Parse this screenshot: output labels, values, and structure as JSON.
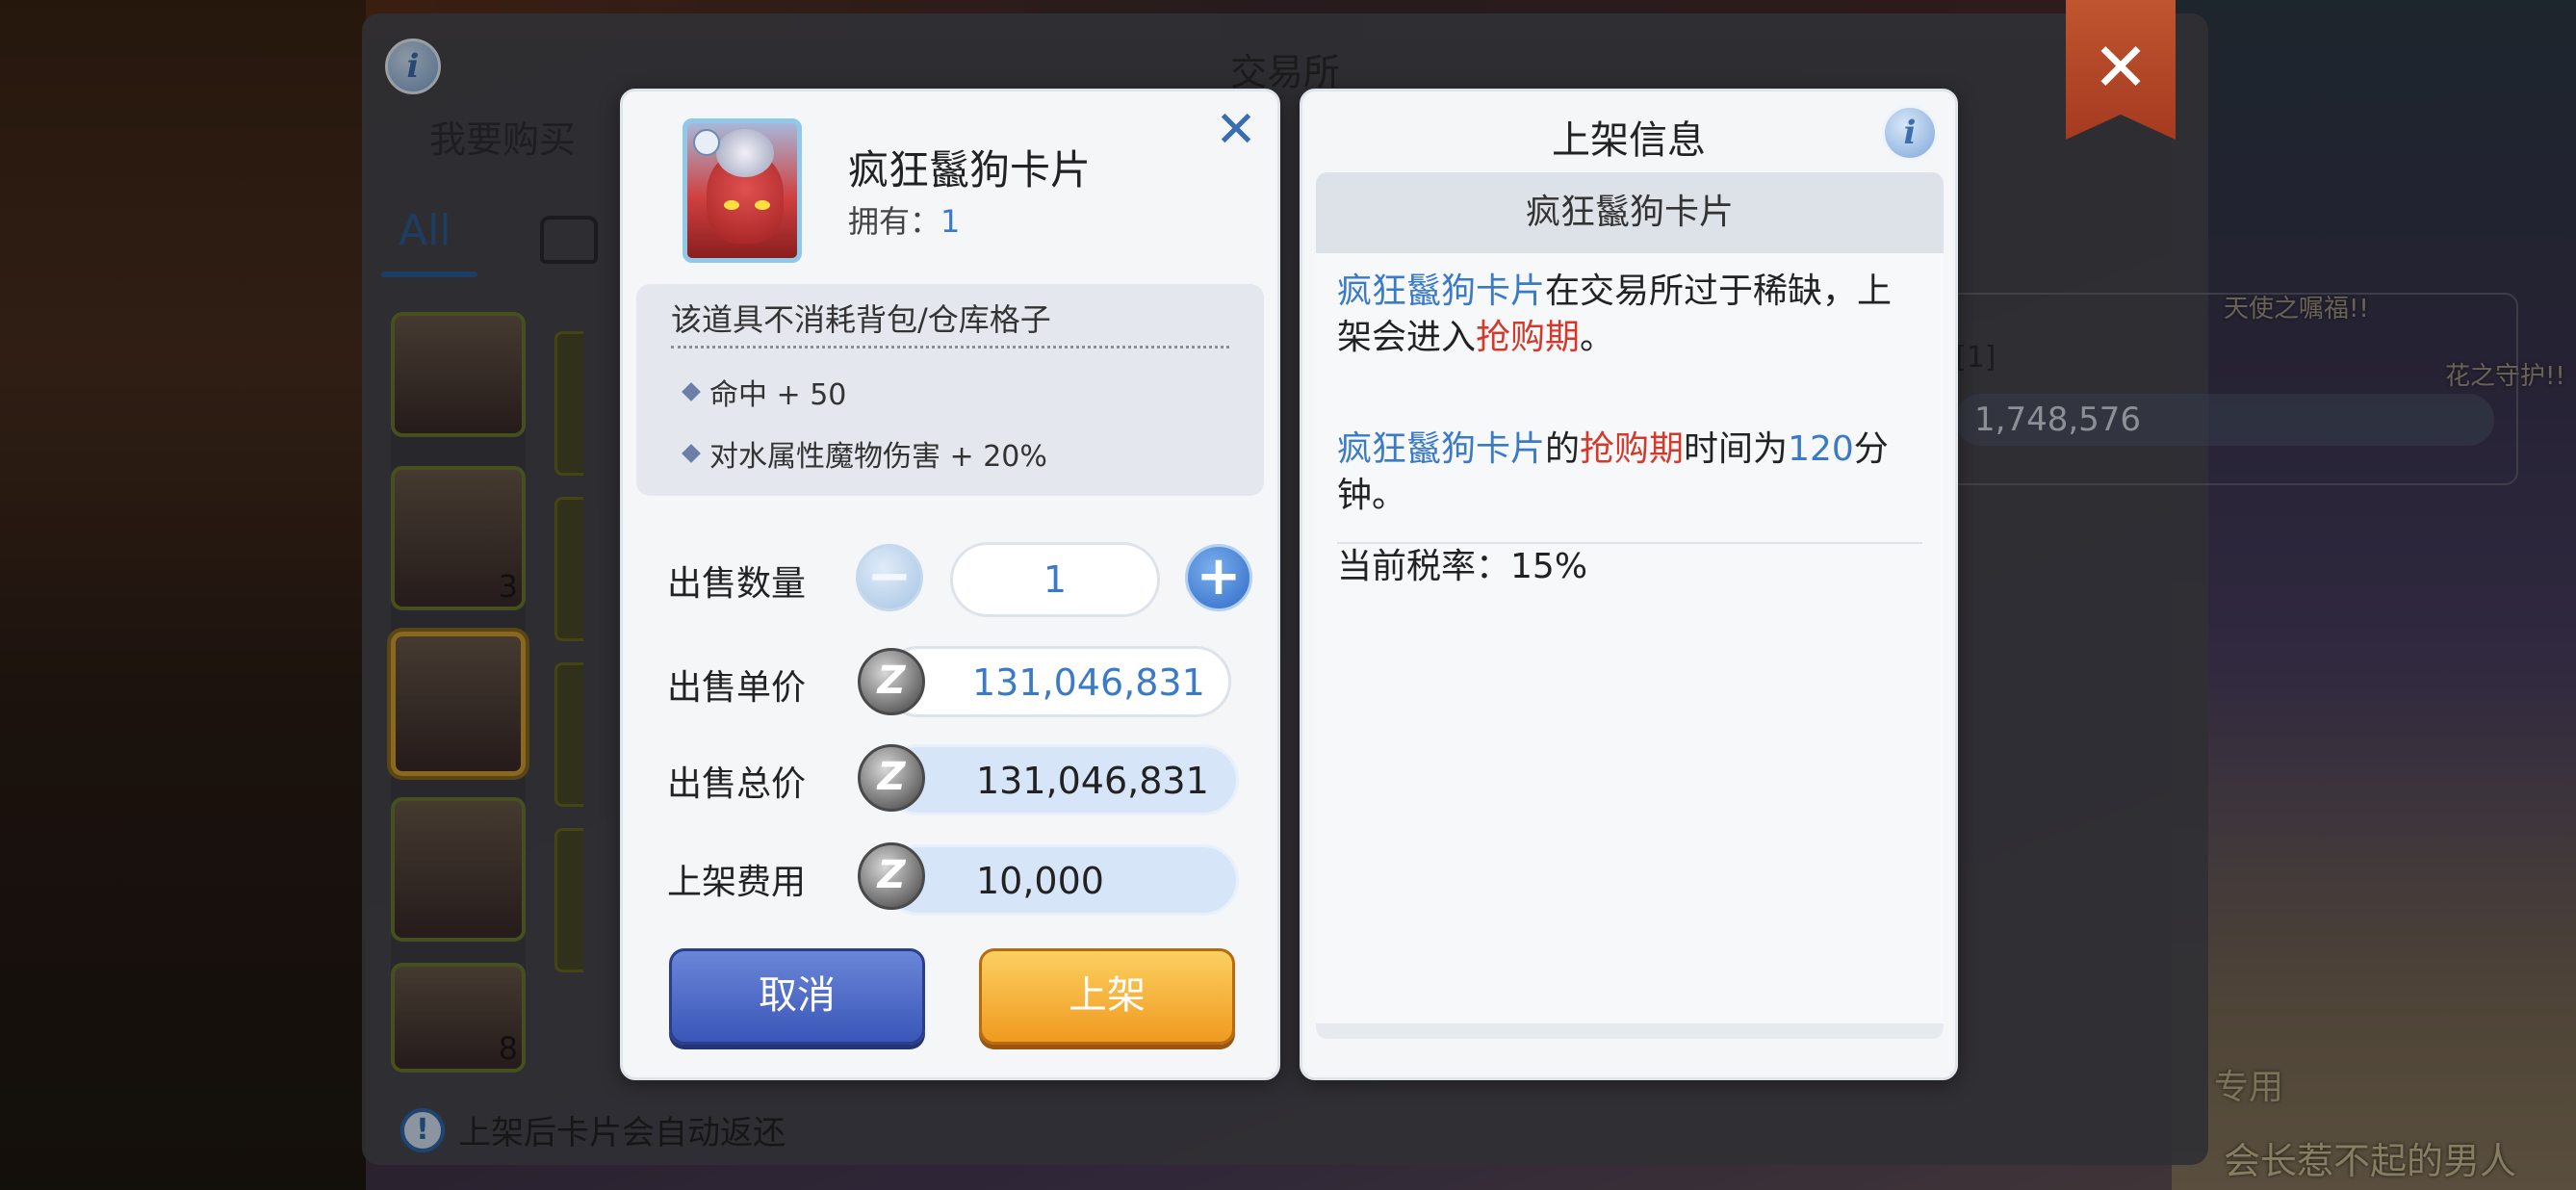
{
  "background": {
    "top_right_text_1": "天使之嘱福!!",
    "top_right_text_2": "花之守护!!",
    "bottom_right_text_1": "专用",
    "bottom_right_text_2": "会长惹不起的男人"
  },
  "exchange": {
    "title": "交易所",
    "info_icon": "i",
    "tab_buy": "我要购买",
    "filter_all": "All",
    "slot_counts": [
      "3",
      "8"
    ],
    "right_item_suffix": "[1]",
    "right_item_price": "1,748,576",
    "bottom_note": "上架后卡片会自动返还",
    "warning_icon": "!",
    "close_icon": "✕"
  },
  "sell_dialog": {
    "item_name": "疯狂鬣狗卡片",
    "owned_label": "拥有：",
    "owned_count": "1",
    "close_icon": "✕",
    "description_note": "该道具不消耗背包/仓库格子",
    "stats": [
      "命中 + 50",
      "对水属性魔物伤害 + 20%"
    ],
    "quantity_label": "出售数量",
    "quantity_value": "1",
    "minus_icon": "−",
    "plus_icon": "+",
    "unit_price_label": "出售单价",
    "unit_price": "131,046,831",
    "total_price_label": "出售总价",
    "total_price": "131,046,831",
    "listing_fee_label": "上架费用",
    "listing_fee": "10,000",
    "zeny_icon": "Z",
    "cancel_label": "取消",
    "list_label": "上架"
  },
  "info_dialog": {
    "title": "上架信息",
    "info_icon": "i",
    "item_name": "疯狂鬣狗卡片",
    "p1_item": "疯狂鬣狗卡片",
    "p1_text": "在交易所过于稀缺，上架会进入",
    "p1_period": "抢购期",
    "p1_end": "。",
    "p2_item": "疯狂鬣狗卡片",
    "p2_of": "的",
    "p2_period": "抢购期",
    "p2_text": "时间为",
    "p2_minutes": "120",
    "p2_unit": "分钟。",
    "tax_label": "当前税率：",
    "tax_value": "15%"
  },
  "colors": {
    "accent_blue": "#3a7ac8",
    "accent_red": "#d33a2c",
    "cancel_button": "#3a56b8",
    "list_button": "#f09a20"
  }
}
